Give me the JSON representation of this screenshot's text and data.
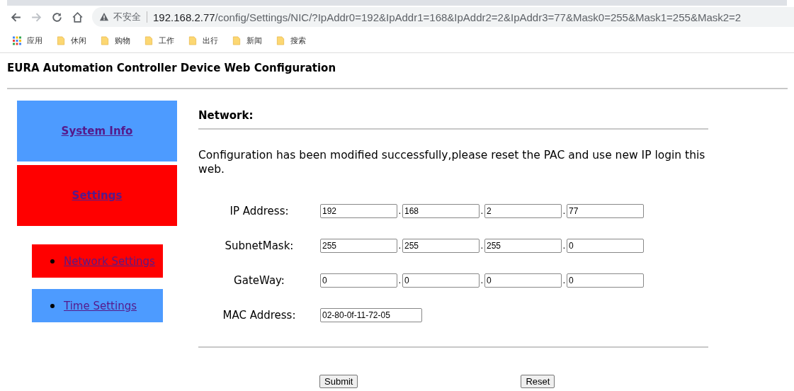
{
  "browser": {
    "security_label": "不安全",
    "url_host": "192.168.2.77",
    "url_path": "/config/Settings/NIC/?IpAddr0=192&IpAddr1=168&IpAddr2=2&IpAddr3=77&Mask0=255&Mask1=255&Mask2=2",
    "bookmarks": [
      {
        "kind": "apps",
        "label": "应用"
      },
      {
        "kind": "folder",
        "label": "休闲"
      },
      {
        "kind": "folder",
        "label": "购物"
      },
      {
        "kind": "folder",
        "label": "工作"
      },
      {
        "kind": "folder",
        "label": "出行"
      },
      {
        "kind": "folder",
        "label": "新闻"
      },
      {
        "kind": "folder",
        "label": "搜索"
      }
    ]
  },
  "page_title": "EURA Automation Controller Device Web Configuration",
  "nav": [
    {
      "label": "System Info",
      "selected": false,
      "kind": "main"
    },
    {
      "label": "Settings",
      "selected": true,
      "kind": "main"
    },
    {
      "label": "Network Settings",
      "selected": true,
      "kind": "sub"
    },
    {
      "label": "Time Settings",
      "selected": false,
      "kind": "sub"
    }
  ],
  "section_title": "Network:",
  "message": "Configuration has been modified successfully,please reset the PAC and use new IP login this web.",
  "rows": [
    {
      "label": "IP Address:",
      "fields": [
        {
          "value": "192"
        },
        {
          "dot": ".",
          "value": "168"
        },
        {
          "dot": ".",
          "value": "2"
        },
        {
          "dot": ".",
          "value": "77"
        }
      ]
    },
    {
      "label": "SubnetMask:",
      "fields": [
        {
          "value": "255"
        },
        {
          "dot": ".",
          "value": "255"
        },
        {
          "dot": ".",
          "value": "255"
        },
        {
          "dot": ".",
          "value": "0"
        }
      ]
    },
    {
      "label": "GateWay:",
      "fields": [
        {
          "value": "0"
        },
        {
          "dot": ".",
          "value": "0"
        },
        {
          "dot": ".",
          "value": "0"
        },
        {
          "dot": ".",
          "value": "0"
        }
      ]
    },
    {
      "label": "MAC Address:",
      "fields": [
        {
          "value": "02-80-0f-11-72-05",
          "kind": "wide"
        }
      ]
    }
  ],
  "buttons": [
    "Submit",
    "Reset"
  ]
}
